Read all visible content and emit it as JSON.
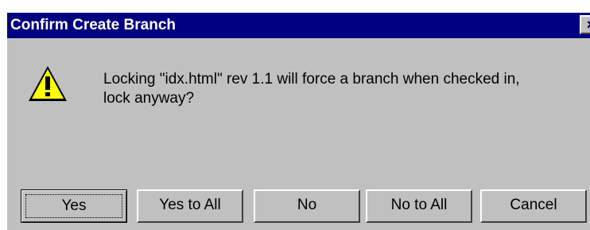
{
  "window": {
    "title": "Confirm Create Branch",
    "close_glyph": "×"
  },
  "message": {
    "line1": "Locking \"idx.html\" rev 1.1 will force a branch when checked in,",
    "line2": "lock anyway?"
  },
  "icon": {
    "name": "warning-icon",
    "fill_color": "#ffff00",
    "mark": "!"
  },
  "buttons": {
    "yes": "Yes",
    "yes_to_all": "Yes to All",
    "no": "No",
    "no_to_all": "No to All",
    "cancel": "Cancel"
  }
}
